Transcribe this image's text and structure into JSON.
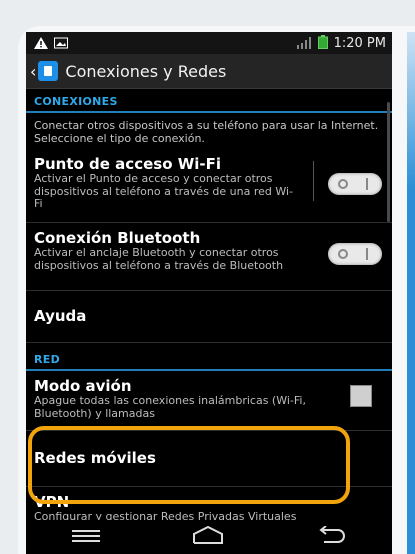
{
  "status_bar": {
    "time": "1:20 PM"
  },
  "action_bar": {
    "title": "Conexiones y Redes"
  },
  "sections": {
    "conexiones": {
      "header": "CONEXIONES",
      "description": "Conectar otros dispositivos a su teléfono para usar la Internet. Seleccione el tipo de conexión."
    },
    "red": {
      "header": "RED"
    }
  },
  "items": {
    "wifi_hotspot": {
      "title": "Punto de acceso Wi-Fi",
      "subtitle": "Activar el Punto de acceso y conectar otros dispositivos al teléfono a través de una red Wi-Fi"
    },
    "bluetooth": {
      "title": "Conexión Bluetooth",
      "subtitle": "Activar el anclaje Bluetooth y conectar otros dispositivos al teléfono a través de Bluetooth"
    },
    "help": {
      "title": "Ayuda"
    },
    "airplane": {
      "title": "Modo avión",
      "subtitle": "Apague todas las conexiones inalámbricas (Wi-Fi, Bluetooth) y llamadas"
    },
    "mobile_networks": {
      "title": "Redes móviles"
    },
    "vpn": {
      "title": "VPN",
      "subtitle": "Configurar y gestionar Redes Privadas Virtuales"
    }
  },
  "colors": {
    "accent": "#31a8e8",
    "highlight": "#f2a40d"
  },
  "icons": [
    "warning-icon",
    "image-icon",
    "signal-icon",
    "battery-icon",
    "back-icon",
    "home-icon",
    "menu-icon"
  ]
}
